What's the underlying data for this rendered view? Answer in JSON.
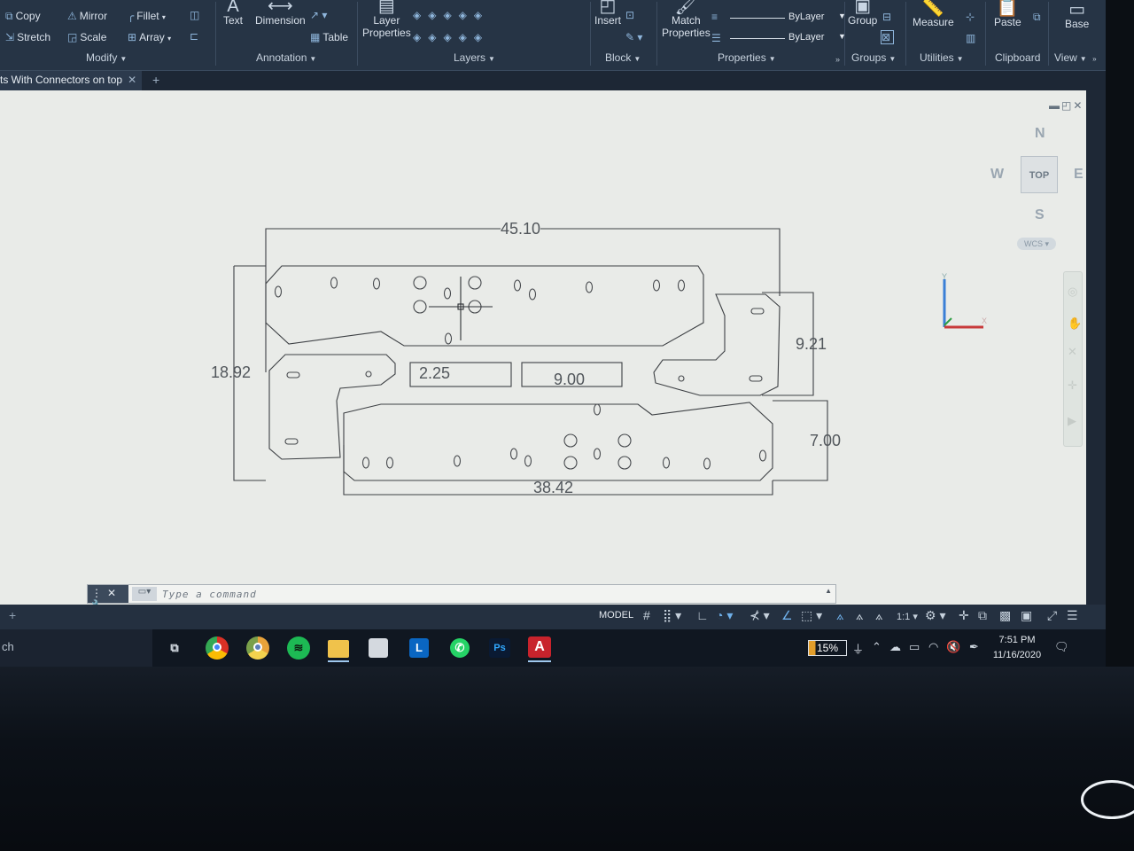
{
  "ribbon": {
    "modify": {
      "copy": "Copy",
      "mirror": "Mirror",
      "fillet": "Fillet",
      "stretch": "Stretch",
      "scale": "Scale",
      "array": "Array",
      "label": "Modify"
    },
    "annotation": {
      "text": "Text",
      "dimension": "Dimension",
      "table": "Table",
      "label": "Annotation"
    },
    "layers": {
      "layer_properties_1": "Layer",
      "layer_properties_2": "Properties",
      "label": "Layers"
    },
    "block": {
      "insert": "Insert",
      "label": "Block"
    },
    "properties": {
      "match_1": "Match",
      "match_2": "Properties",
      "linetype": "ByLayer",
      "lineweight": "ByLayer",
      "label": "Properties"
    },
    "groups": {
      "group": "Group",
      "label": "Groups"
    },
    "utilities": {
      "measure": "Measure",
      "label": "Utilities"
    },
    "clipboard": {
      "paste": "Paste",
      "label": "Clipboard"
    },
    "view": {
      "base": "Base",
      "label": "View"
    }
  },
  "tab": {
    "title": "ts With Connectors on top",
    "close": "✕",
    "add": "+"
  },
  "viewcube": {
    "north": "N",
    "south": "S",
    "east": "E",
    "west": "W",
    "top": "TOP",
    "wcs": "WCS ▾"
  },
  "dimensions": {
    "overall_width": "45.10",
    "left_height": "18.92",
    "right_height": "9.21",
    "bottom_right_height": "7.00",
    "bottom_width": "38.42",
    "box_a": "2.25",
    "box_b": "9.00"
  },
  "command_line": {
    "placeholder": "Type a command"
  },
  "status_bar": {
    "model": "MODEL",
    "scale": "1:1"
  },
  "taskbar": {
    "search": "ch",
    "battery": "15%",
    "time": "7:51 PM",
    "date": "11/16/2020",
    "apps": [
      "task-view",
      "chrome",
      "chrome-canary",
      "spotify",
      "file-explorer",
      "store",
      "linkedin-learning",
      "whatsapp",
      "photoshop",
      "autocad"
    ],
    "app_labels": {
      "linkedin": "L",
      "photoshop": "Ps",
      "autocad": "A"
    }
  },
  "colors": {
    "ribbon": "#263445",
    "canvas": "#e9ebe8",
    "accent": "#6fb0ea",
    "autocad": "#c8232c"
  }
}
